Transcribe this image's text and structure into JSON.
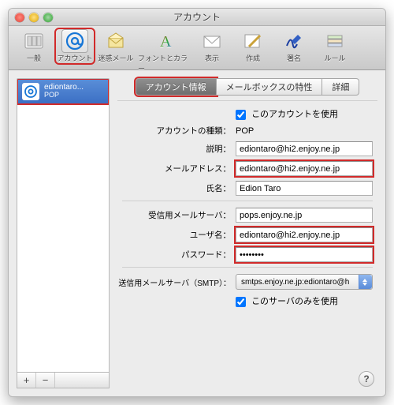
{
  "window": {
    "title": "アカウント"
  },
  "toolbar": {
    "items": [
      {
        "label": "一般"
      },
      {
        "label": "アカウント",
        "selected": true
      },
      {
        "label": "迷惑メール"
      },
      {
        "label": "フォントとカラー"
      },
      {
        "label": "表示"
      },
      {
        "label": "作成"
      },
      {
        "label": "署名"
      },
      {
        "label": "ルール"
      }
    ]
  },
  "sidebar": {
    "items": [
      {
        "name": "ediontaro...",
        "type": "POP",
        "selected": true
      }
    ],
    "add": "+",
    "remove": "−"
  },
  "tabs": {
    "items": [
      {
        "label": "アカウント情報",
        "active": true
      },
      {
        "label": "メールボックスの特性"
      },
      {
        "label": "詳細"
      }
    ]
  },
  "form": {
    "enable_label": "このアカウントを使用",
    "enable_checked": true,
    "acct_type_label": "アカウントの種類：",
    "acct_type_value": "POP",
    "desc_label": "説明：",
    "desc_value": "ediontaro@hi2.enjoy.ne.jp",
    "email_label": "メールアドレス：",
    "email_value": "ediontaro@hi2.enjoy.ne.jp",
    "name_label": "氏名：",
    "name_value": "Edion Taro",
    "in_server_label": "受信用メールサーバ：",
    "in_server_value": "pops.enjoy.ne.jp",
    "user_label": "ユーザ名：",
    "user_value": "ediontaro@hi2.enjoy.ne.jp",
    "pass_label": "パスワード：",
    "pass_value": "••••••••",
    "smtp_label": "送信用メールサーバ（SMTP）：",
    "smtp_value": "smtps.enjoy.ne.jp:ediontaro@h",
    "smtp_only_label": "このサーバのみを使用",
    "smtp_only_checked": true
  },
  "help_button": "?"
}
